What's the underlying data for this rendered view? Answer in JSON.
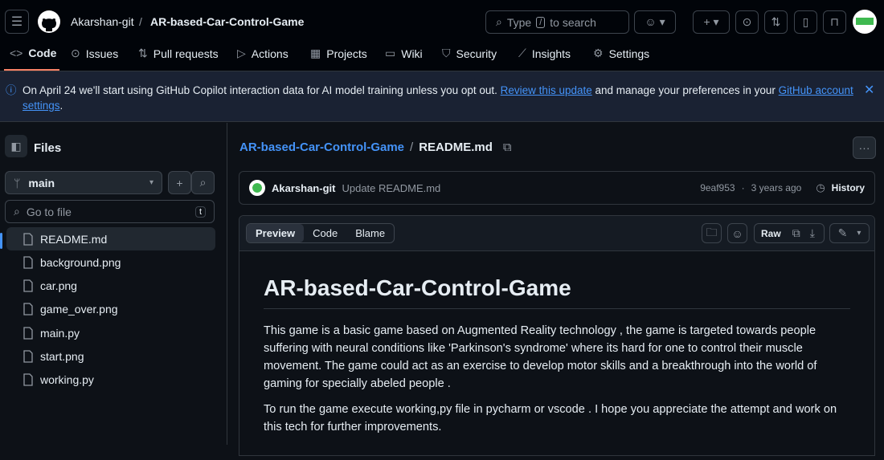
{
  "header": {
    "owner": "Akarshan-git",
    "separator": "/",
    "repo": "AR-based-Car-Control-Game",
    "search_prefix": "Type",
    "search_key": "/",
    "search_suffix": "to search"
  },
  "nav": [
    {
      "label": "Code"
    },
    {
      "label": "Issues"
    },
    {
      "label": "Pull requests"
    },
    {
      "label": "Actions"
    },
    {
      "label": "Projects"
    },
    {
      "label": "Wiki"
    },
    {
      "label": "Security"
    },
    {
      "label": "Insights"
    },
    {
      "label": "Settings"
    }
  ],
  "banner": {
    "text1": "On April 24 we'll start using GitHub Copilot interaction data for AI model training unless you opt out.",
    "link1": "Review this update",
    "text2": "and manage your preferences in your",
    "link2": "GitHub account settings",
    "text3": "."
  },
  "sidebar": {
    "title": "Files",
    "branch": "main",
    "goto_placeholder": "Go to file",
    "goto_key": "t",
    "files": [
      "README.md",
      "background.png",
      "car.png",
      "game_over.png",
      "main.py",
      "start.png",
      "working.py"
    ]
  },
  "breadcrumb": {
    "repo": "AR-based-Car-Control-Game",
    "sep": "/",
    "file": "README.md"
  },
  "commit": {
    "author": "Akarshan-git",
    "message": "Update README.md",
    "sha": "9eaf953",
    "sep": "·",
    "age": "3 years ago",
    "history": "History"
  },
  "viewer": {
    "tabs": [
      "Preview",
      "Code",
      "Blame"
    ],
    "raw": "Raw"
  },
  "readme": {
    "title": "AR-based-Car-Control-Game",
    "p1": "This game is a basic game based on Augmented Reality technology , the game is targeted towards people suffering with neural conditions like 'Parkinson's syndrome' where its hard for one to control their muscle movement. The game could act as an exercise to develop motor skills and a breakthrough into the world of gaming for specially abeled people .",
    "p2": "To run the game execute working,py file in pycharm or vscode . I hope you appreciate the attempt and work on this tech for further improvements."
  }
}
